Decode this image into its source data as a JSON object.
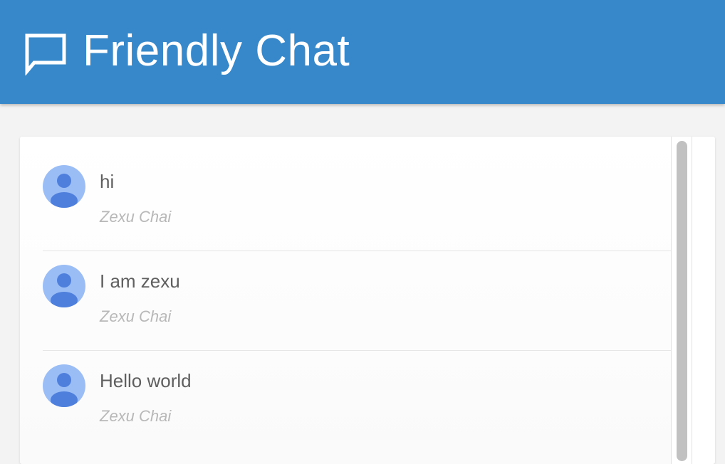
{
  "header": {
    "title": "Friendly Chat",
    "background_color": "#3788cb",
    "icon": "chat-bubble-icon"
  },
  "messages": [
    {
      "text": "hi",
      "author": "Zexu Chai",
      "avatar_icon": "person-avatar-icon"
    },
    {
      "text": "I am zexu",
      "author": "Zexu Chai",
      "avatar_icon": "person-avatar-icon"
    },
    {
      "text": "Hello world",
      "author": "Zexu Chai",
      "avatar_icon": "person-avatar-icon"
    }
  ],
  "colors": {
    "avatar_bg": "#9bbdf5",
    "avatar_fg": "#4e7fdc",
    "message_text": "#5f5f5f",
    "author_text": "#b8b8b8"
  }
}
